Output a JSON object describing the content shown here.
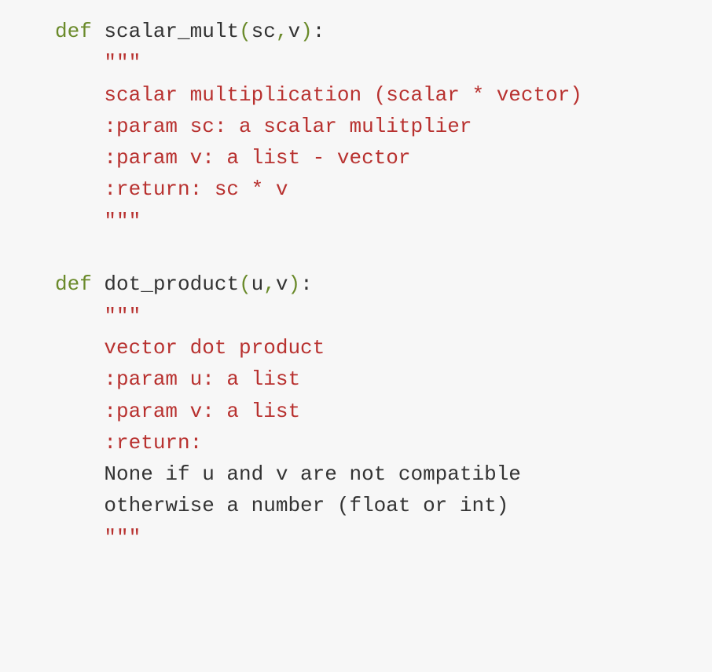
{
  "code": {
    "func1": {
      "def_kw": "def",
      "name": "scalar_mult",
      "lparen": "(",
      "param1": "sc",
      "comma": ",",
      "param2": "v",
      "rparen": ")",
      "colon": ":",
      "doc_open": "    \"\"\"",
      "doc_line1": "    scalar multiplication (scalar * vector)",
      "doc_line2": "    :param sc: a scalar mulitplier",
      "doc_line3": "    :param v: a list - vector",
      "doc_line4": "    :return: sc * v",
      "doc_close": "    \"\"\""
    },
    "blank": "",
    "func2": {
      "def_kw": "def",
      "name": "dot_product",
      "lparen": "(",
      "param1": "u",
      "comma": ",",
      "param2": "v",
      "rparen": ")",
      "colon": ":",
      "doc_open": "    \"\"\"",
      "doc_line1": "    vector dot product",
      "doc_line2": "    :param u: a list",
      "doc_line3": "    :param v: a list",
      "doc_line4": "    :return:",
      "doc_line5": "    None if u and v are not compatible",
      "doc_line6": "    otherwise a number (float or int)",
      "doc_close": "    \"\"\""
    }
  }
}
